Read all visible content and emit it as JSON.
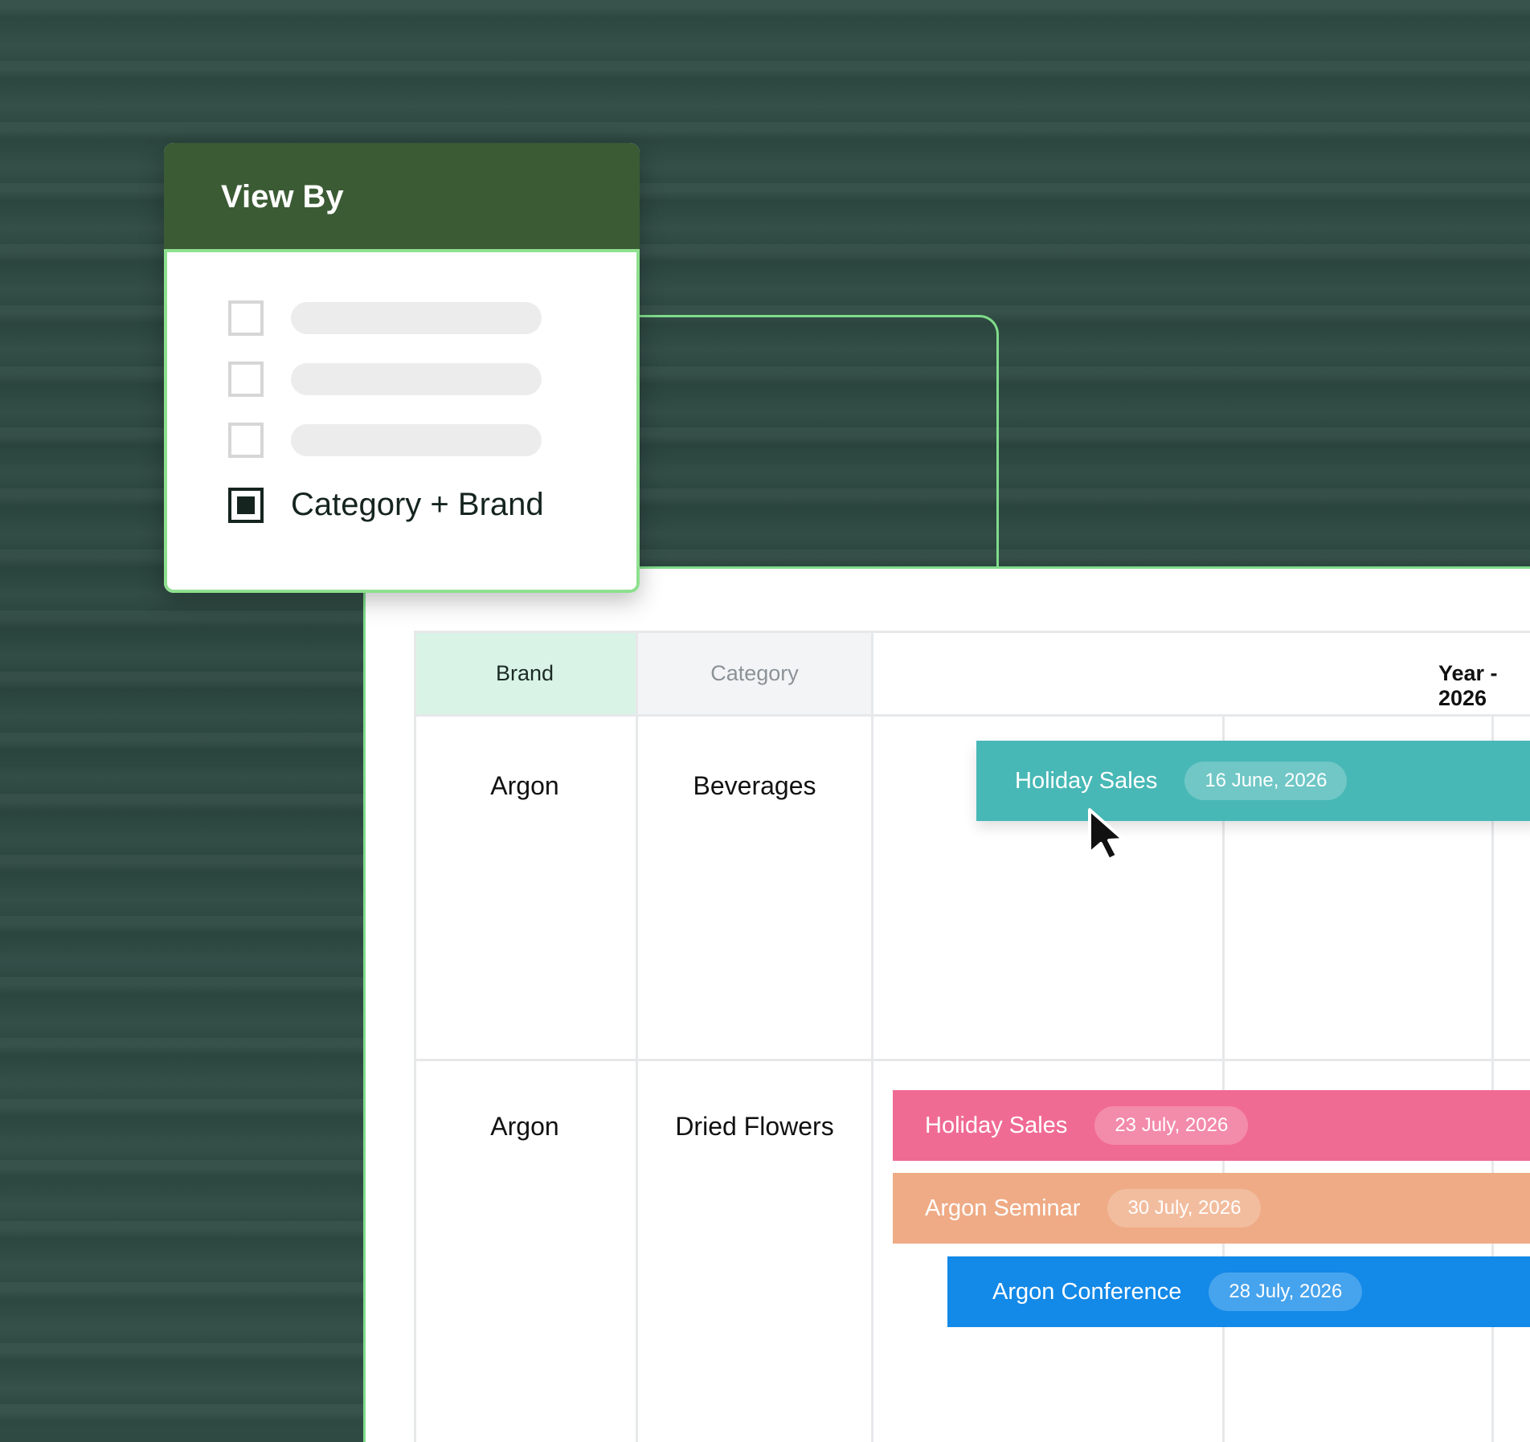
{
  "view_by": {
    "title": "View By",
    "options": [
      {
        "label": "",
        "checked": false
      },
      {
        "label": "",
        "checked": false
      },
      {
        "label": "",
        "checked": false
      },
      {
        "label": "Category + Brand",
        "checked": true
      }
    ]
  },
  "table": {
    "headers": {
      "brand": "Brand",
      "category": "Category",
      "timeline": "Year - 2026"
    },
    "rows": [
      {
        "brand": "Argon",
        "category": "Beverages",
        "events": [
          {
            "name": "Holiday Sales",
            "date": "16 June, 2026",
            "color": "#48b8b6"
          }
        ]
      },
      {
        "brand": "Argon",
        "category": "Dried Flowers",
        "events": [
          {
            "name": "Holiday Sales",
            "date": "23 July, 2026",
            "color": "#f06b93"
          },
          {
            "name": "Argon Seminar",
            "date": "30 July, 2026",
            "color": "#efab85"
          },
          {
            "name": "Argon Conference",
            "date": "28 July, 2026",
            "color": "#1389e8"
          }
        ]
      }
    ]
  },
  "colors": {
    "accent_green": "#7fdc8a",
    "panel_header": "#3b5b34",
    "background": "#2e4a42"
  }
}
